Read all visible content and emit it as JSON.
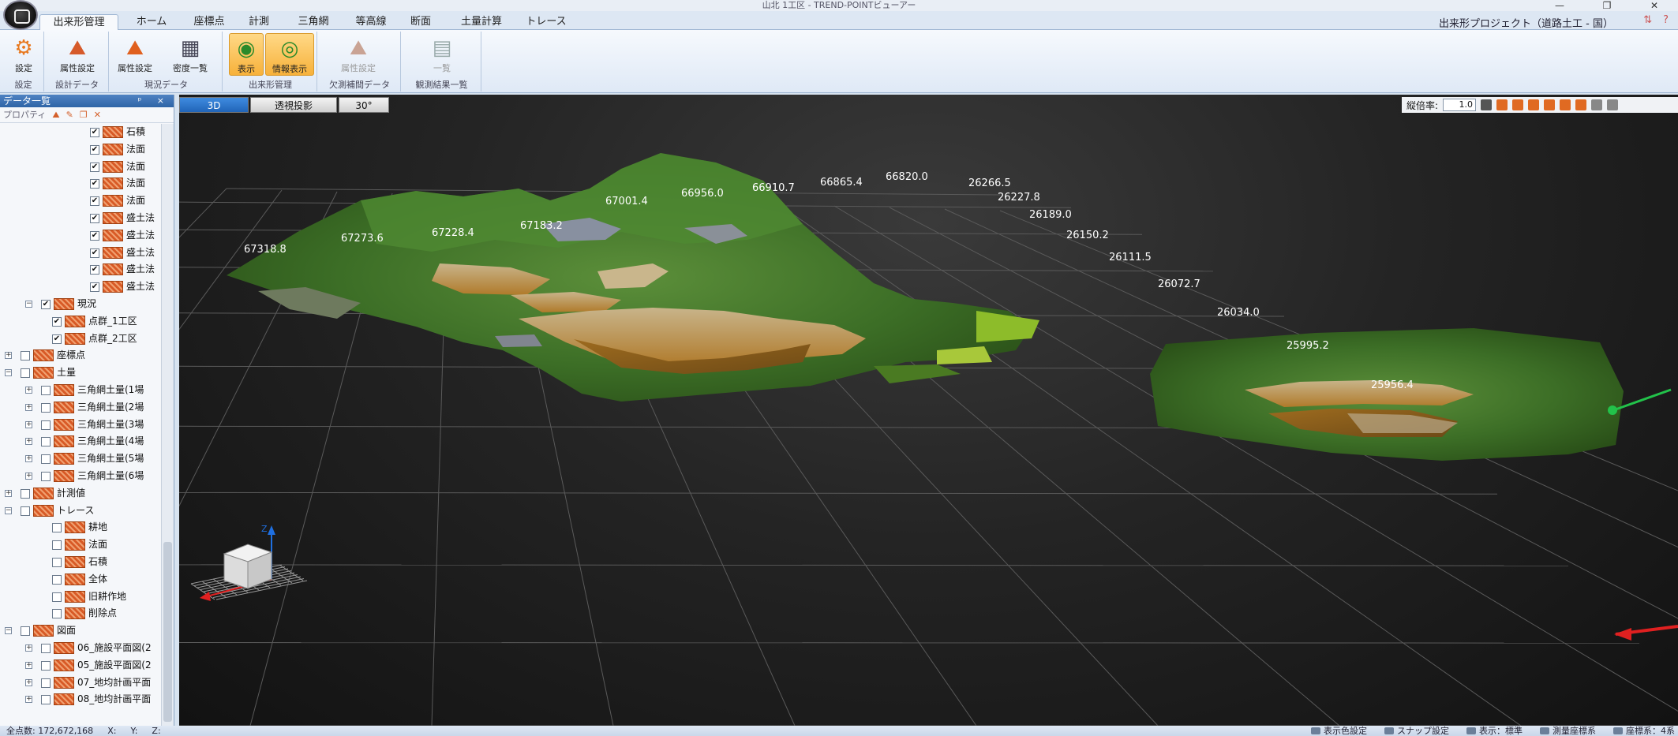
{
  "window": {
    "title": "山北 1工区 - TREND-POINTビューアー",
    "controls": [
      "—",
      "❐",
      "✕"
    ]
  },
  "tabs": [
    "出来形管理",
    "ホーム",
    "座標点",
    "計測",
    "三角網",
    "等高線",
    "断面",
    "土量計算",
    "トレース"
  ],
  "active_tab": "出来形管理",
  "project_name": "出来形プロジェクト（道路土工 - 国）",
  "ribbon": {
    "groups": [
      {
        "label": "設定",
        "buttons": [
          {
            "label": "設定",
            "icon": "gear-icon"
          }
        ]
      },
      {
        "label": "設計データ",
        "buttons": [
          {
            "label": "属性設定",
            "icon": "attribute-icon"
          }
        ]
      },
      {
        "label": "現況データ",
        "buttons": [
          {
            "label": "属性設定",
            "icon": "attribute-icon"
          },
          {
            "label": "密度一覧",
            "icon": "grid-table-icon"
          }
        ]
      },
      {
        "label": "出来形管理",
        "buttons": [
          {
            "label": "表示",
            "icon": "display-icon"
          },
          {
            "label": "情報表示",
            "icon": "info-display-icon"
          }
        ]
      },
      {
        "label": "欠測補間データ",
        "buttons": [
          {
            "label": "属性設定",
            "icon": "attribute-icon"
          }
        ]
      },
      {
        "label": "観測結果一覧",
        "buttons": [
          {
            "label": "一覧",
            "icon": "list-icon"
          }
        ]
      }
    ]
  },
  "left_pane": {
    "title": "データ一覧",
    "header_controls": "ᵖ ×",
    "toolbar": [
      "プロパティ",
      "⛰",
      "✎",
      "❐",
      "✕"
    ],
    "rows": [
      {
        "text": "石積",
        "level": 5,
        "checked": true,
        "expander": ""
      },
      {
        "text": "法面",
        "level": 5,
        "checked": true,
        "expander": ""
      },
      {
        "text": "法面",
        "level": 5,
        "checked": true,
        "expander": ""
      },
      {
        "text": "法面",
        "level": 5,
        "checked": true,
        "expander": ""
      },
      {
        "text": "法面",
        "level": 5,
        "checked": true,
        "expander": ""
      },
      {
        "text": "盛土法",
        "level": 5,
        "checked": true,
        "expander": ""
      },
      {
        "text": "盛土法",
        "level": 5,
        "checked": true,
        "expander": ""
      },
      {
        "text": "盛土法",
        "level": 5,
        "checked": true,
        "expander": ""
      },
      {
        "text": "盛土法",
        "level": 5,
        "checked": true,
        "expander": ""
      },
      {
        "text": "盛土法",
        "level": 5,
        "checked": true,
        "expander": ""
      },
      {
        "text": "現況",
        "level": 2,
        "checked": true,
        "expander": "−"
      },
      {
        "text": "点群_1工区",
        "level": 3,
        "checked": true,
        "expander": ""
      },
      {
        "text": "点群_2工区",
        "level": 3,
        "checked": true,
        "expander": ""
      },
      {
        "text": "座標点",
        "level": 1,
        "checked": false,
        "expander": "+"
      },
      {
        "text": "土量",
        "level": 1,
        "checked": false,
        "expander": "−"
      },
      {
        "text": "三角網土量(1場",
        "level": 2,
        "checked": false,
        "expander": "+"
      },
      {
        "text": "三角網土量(2場",
        "level": 2,
        "checked": false,
        "expander": "+"
      },
      {
        "text": "三角網土量(3場",
        "level": 2,
        "checked": false,
        "expander": "+"
      },
      {
        "text": "三角網土量(4場",
        "level": 2,
        "checked": false,
        "expander": "+"
      },
      {
        "text": "三角網土量(5場",
        "level": 2,
        "checked": false,
        "expander": "+"
      },
      {
        "text": "三角網土量(6場",
        "level": 2,
        "checked": false,
        "expander": "+"
      },
      {
        "text": "計測値",
        "level": 1,
        "checked": false,
        "expander": "+"
      },
      {
        "text": "トレース",
        "level": 1,
        "checked": false,
        "expander": "−"
      },
      {
        "text": "耕地",
        "level": 3,
        "checked": false,
        "expander": ""
      },
      {
        "text": "法面",
        "level": 3,
        "checked": false,
        "expander": ""
      },
      {
        "text": "石積",
        "level": 3,
        "checked": false,
        "expander": ""
      },
      {
        "text": "全体",
        "level": 3,
        "checked": false,
        "expander": ""
      },
      {
        "text": "旧耕作地",
        "level": 3,
        "checked": false,
        "expander": ""
      },
      {
        "text": "削除点",
        "level": 3,
        "checked": false,
        "expander": ""
      },
      {
        "text": "図面",
        "level": 1,
        "checked": false,
        "expander": "−"
      },
      {
        "text": "06_施設平面図(2",
        "level": 2,
        "checked": false,
        "expander": "+"
      },
      {
        "text": "05_施設平面図(2",
        "level": 2,
        "checked": false,
        "expander": "+"
      },
      {
        "text": "07_地均計画平面",
        "level": 2,
        "checked": false,
        "expander": "+"
      },
      {
        "text": "08_地均計画平面",
        "level": 2,
        "checked": false,
        "expander": "+"
      }
    ]
  },
  "viewport": {
    "view_tabs": [
      "3D",
      "透視投影",
      "30°"
    ],
    "vertical_exaggeration_label": "縦倍率:",
    "vertical_exaggeration": "1.0",
    "x_axis_labels": [
      "67318.8",
      "67273.6",
      "67228.4",
      "67183.2",
      "67001.4",
      "66956.0",
      "66910.7",
      "66865.4",
      "66820.0"
    ],
    "y_axis_labels": [
      "26266.5",
      "26227.8",
      "26189.0",
      "26150.2",
      "26111.5",
      "26072.7",
      "26034.0",
      "25995.2",
      "25956.4"
    ],
    "axis_gizmo_label": "Z"
  },
  "status": {
    "point_count": "全点数: 172,672,168",
    "x": "X:",
    "y": "Y:",
    "z": "Z:",
    "items": [
      "表示色設定",
      "スナップ設定",
      "表示：標準",
      "測量座標系",
      "座標系：4系"
    ]
  },
  "colors": {
    "accent": "#2a6bbd",
    "ribbon_active": "#f7b13a",
    "grid": "#4a4a4a",
    "x_axis": "#e02020",
    "y_axis": "#22c24a",
    "z_axis": "#1f6fe0"
  }
}
